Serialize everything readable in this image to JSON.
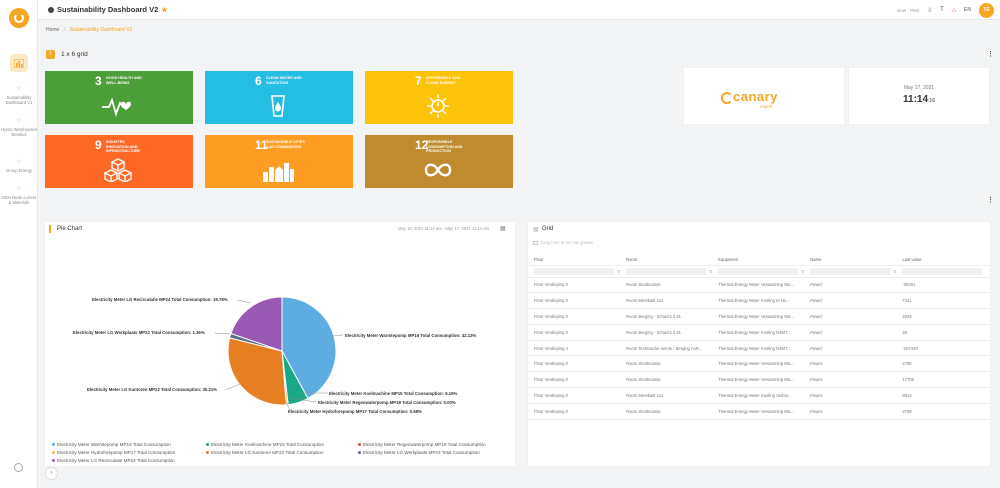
{
  "app": {
    "title": "Sustainability Dashboard V2",
    "top_right_text": "Now - Past",
    "language": "EN",
    "avatar_initials": "TE"
  },
  "breadcrumb": {
    "home": "Home",
    "current": "Sustainability Dashboard V2"
  },
  "sidebar": {
    "items": [
      {
        "label": "Sustainability Dashboard V1"
      },
      {
        "label": "Hydro Warehouses Benelux"
      },
      {
        "label": "Group Energy"
      },
      {
        "label": "NGH Node current & Materials"
      }
    ]
  },
  "section1": {
    "badge": "1",
    "title": "1 x 6 grid"
  },
  "tiles": [
    {
      "num": "3",
      "text": "Good health and well-being",
      "color": "#4c9f38"
    },
    {
      "num": "6",
      "text": "Clean water and sanitation",
      "color": "#26bde2"
    },
    {
      "num": "7",
      "text": "Affordable and clean energy",
      "color": "#fcc30b"
    },
    {
      "num": "9",
      "text": "Industry, innovation and infrastructure",
      "color": "#fd6925"
    },
    {
      "num": "11",
      "text": "Sustainable cities and communities",
      "color": "#fd9d24"
    },
    {
      "num": "12",
      "text": "Responsible consumption and production",
      "color": "#bf8b2e"
    }
  ],
  "canary": {
    "word": "canary",
    "sub": "expert"
  },
  "clock": {
    "date": "May 17, 2021",
    "time": "11:14",
    "seconds": ":16"
  },
  "pie": {
    "title": "Pie Chart",
    "range": "May 16, 2021 11:14 am - May 17, 2021 11:14 am",
    "labels": {
      "l1": "Electricity Meter LG Recirculatie MP24 Total Consumption: 19.78%",
      "l2": "Electricity Meter LG Werkplaats MP23 Total Consumption: 1.36%",
      "l3": "Electricity Meter LG Kantoren MP22 Total Consumption: 30.21%",
      "l4": "Electricity Meter Warmtepomp MP16 Total Consumption: 42.13%",
      "l5": "Electricity Meter Koelmachine MP15 Total Consumption: 6.16%",
      "l6": "Electricity Meter Regenwaterpomp MP18 Total Consumption: 0.00%",
      "l7": "Electricity Meter Hydroforepomp MP17 Total Consumption: 0.58%"
    },
    "legend": [
      {
        "name": "Electricity Meter Warmtepomp MP16 Total Consumption",
        "color": "#5dade2"
      },
      {
        "name": "Electricity Meter Koelmachine MP15 Total Consumption",
        "color": "#1aa88a"
      },
      {
        "name": "Electricity Meter Regenwaterpomp MP18 Total Consumption",
        "color": "#e74c3c"
      },
      {
        "name": "Electricity Meter Hydroforepomp MP17 Total Consumption",
        "color": "#f4b942"
      },
      {
        "name": "Electricity Meter LG Kantoren MP22 Total Consumption",
        "color": "#e67e22"
      },
      {
        "name": "Electricity Meter LG Werkplaats MP23 Total Consumption",
        "color": "#5b6f8a"
      },
      {
        "name": "Electricity Meter LG Recirculatie MP24 Total Consumption",
        "color": "#9b59b6"
      }
    ]
  },
  "chart_data": {
    "type": "pie",
    "labels": [
      "Electricity Meter Warmtepomp MP16 Total Consumption",
      "Electricity Meter Koelmachine MP15 Total Consumption",
      "Electricity Meter Regenwaterpomp MP18 Total Consumption",
      "Electricity Meter Hydroforepomp MP17 Total Consumption",
      "Electricity Meter LG Kantoren MP22 Total Consumption",
      "Electricity Meter LG Werkplaats MP23 Total Consumption",
      "Electricity Meter LG Recirculatie MP24 Total Consumption"
    ],
    "values": [
      42.13,
      6.16,
      0.0,
      0.58,
      30.21,
      1.36,
      19.78
    ],
    "colors": [
      "#5dade2",
      "#1aa88a",
      "#e74c3c",
      "#f4b942",
      "#e67e22",
      "#5b6f8a",
      "#9b59b6"
    ],
    "title": "Pie Chart",
    "legend": "bottom"
  },
  "grid": {
    "title": "Grid",
    "hint": "Drag here to set row groups",
    "headers": [
      "Floor",
      "Room",
      "Equipment",
      "Name",
      "Last value"
    ],
    "rows": [
      [
        "Floor Verdieping 0",
        "Room Stookruimte",
        "Thermal Energy Meter Verwarming Wo...",
        "Power",
        "-36301"
      ],
      [
        "Floor Verdieping 0",
        "Room Meetkast 121",
        "Thermal Energy Meter Koeling to Ho...",
        "Power",
        "7421"
      ],
      [
        "Floor Verdieping 0",
        "Room Berging - Schacht 2.21",
        "Thermal Energy Meter Verwarming Wa...",
        "Power",
        "2833"
      ],
      [
        "Floor Verdieping 0",
        "Room Berging - Schacht 2.21",
        "Thermal Energy Meter Koeling N3MT...",
        "Power",
        "29"
      ],
      [
        "Floor Verdieping 4",
        "Room Technische ruimte / Berging noR...",
        "Thermal Energy Meter Koeling N3MT...",
        "Power",
        "-107449"
      ],
      [
        "Floor Verdieping 0",
        "Room Stookruimte",
        "Thermal Energy Meter Verwarming Wa...",
        "Power",
        "2780"
      ],
      [
        "Floor Verdieping 0",
        "Room Stookruimte",
        "Thermal Energy Meter Verwarming Wa...",
        "Power",
        "17705"
      ],
      [
        "Floor Verdieping 0",
        "Room Meetkast 121",
        "Thermal Energy Meter Koeling Verbiu...",
        "Power",
        "8913"
      ],
      [
        "Floor Verdieping 0",
        "Room Stookruimte",
        "Thermal Energy Meter Verwarming Wa...",
        "Power",
        "2759"
      ]
    ]
  }
}
